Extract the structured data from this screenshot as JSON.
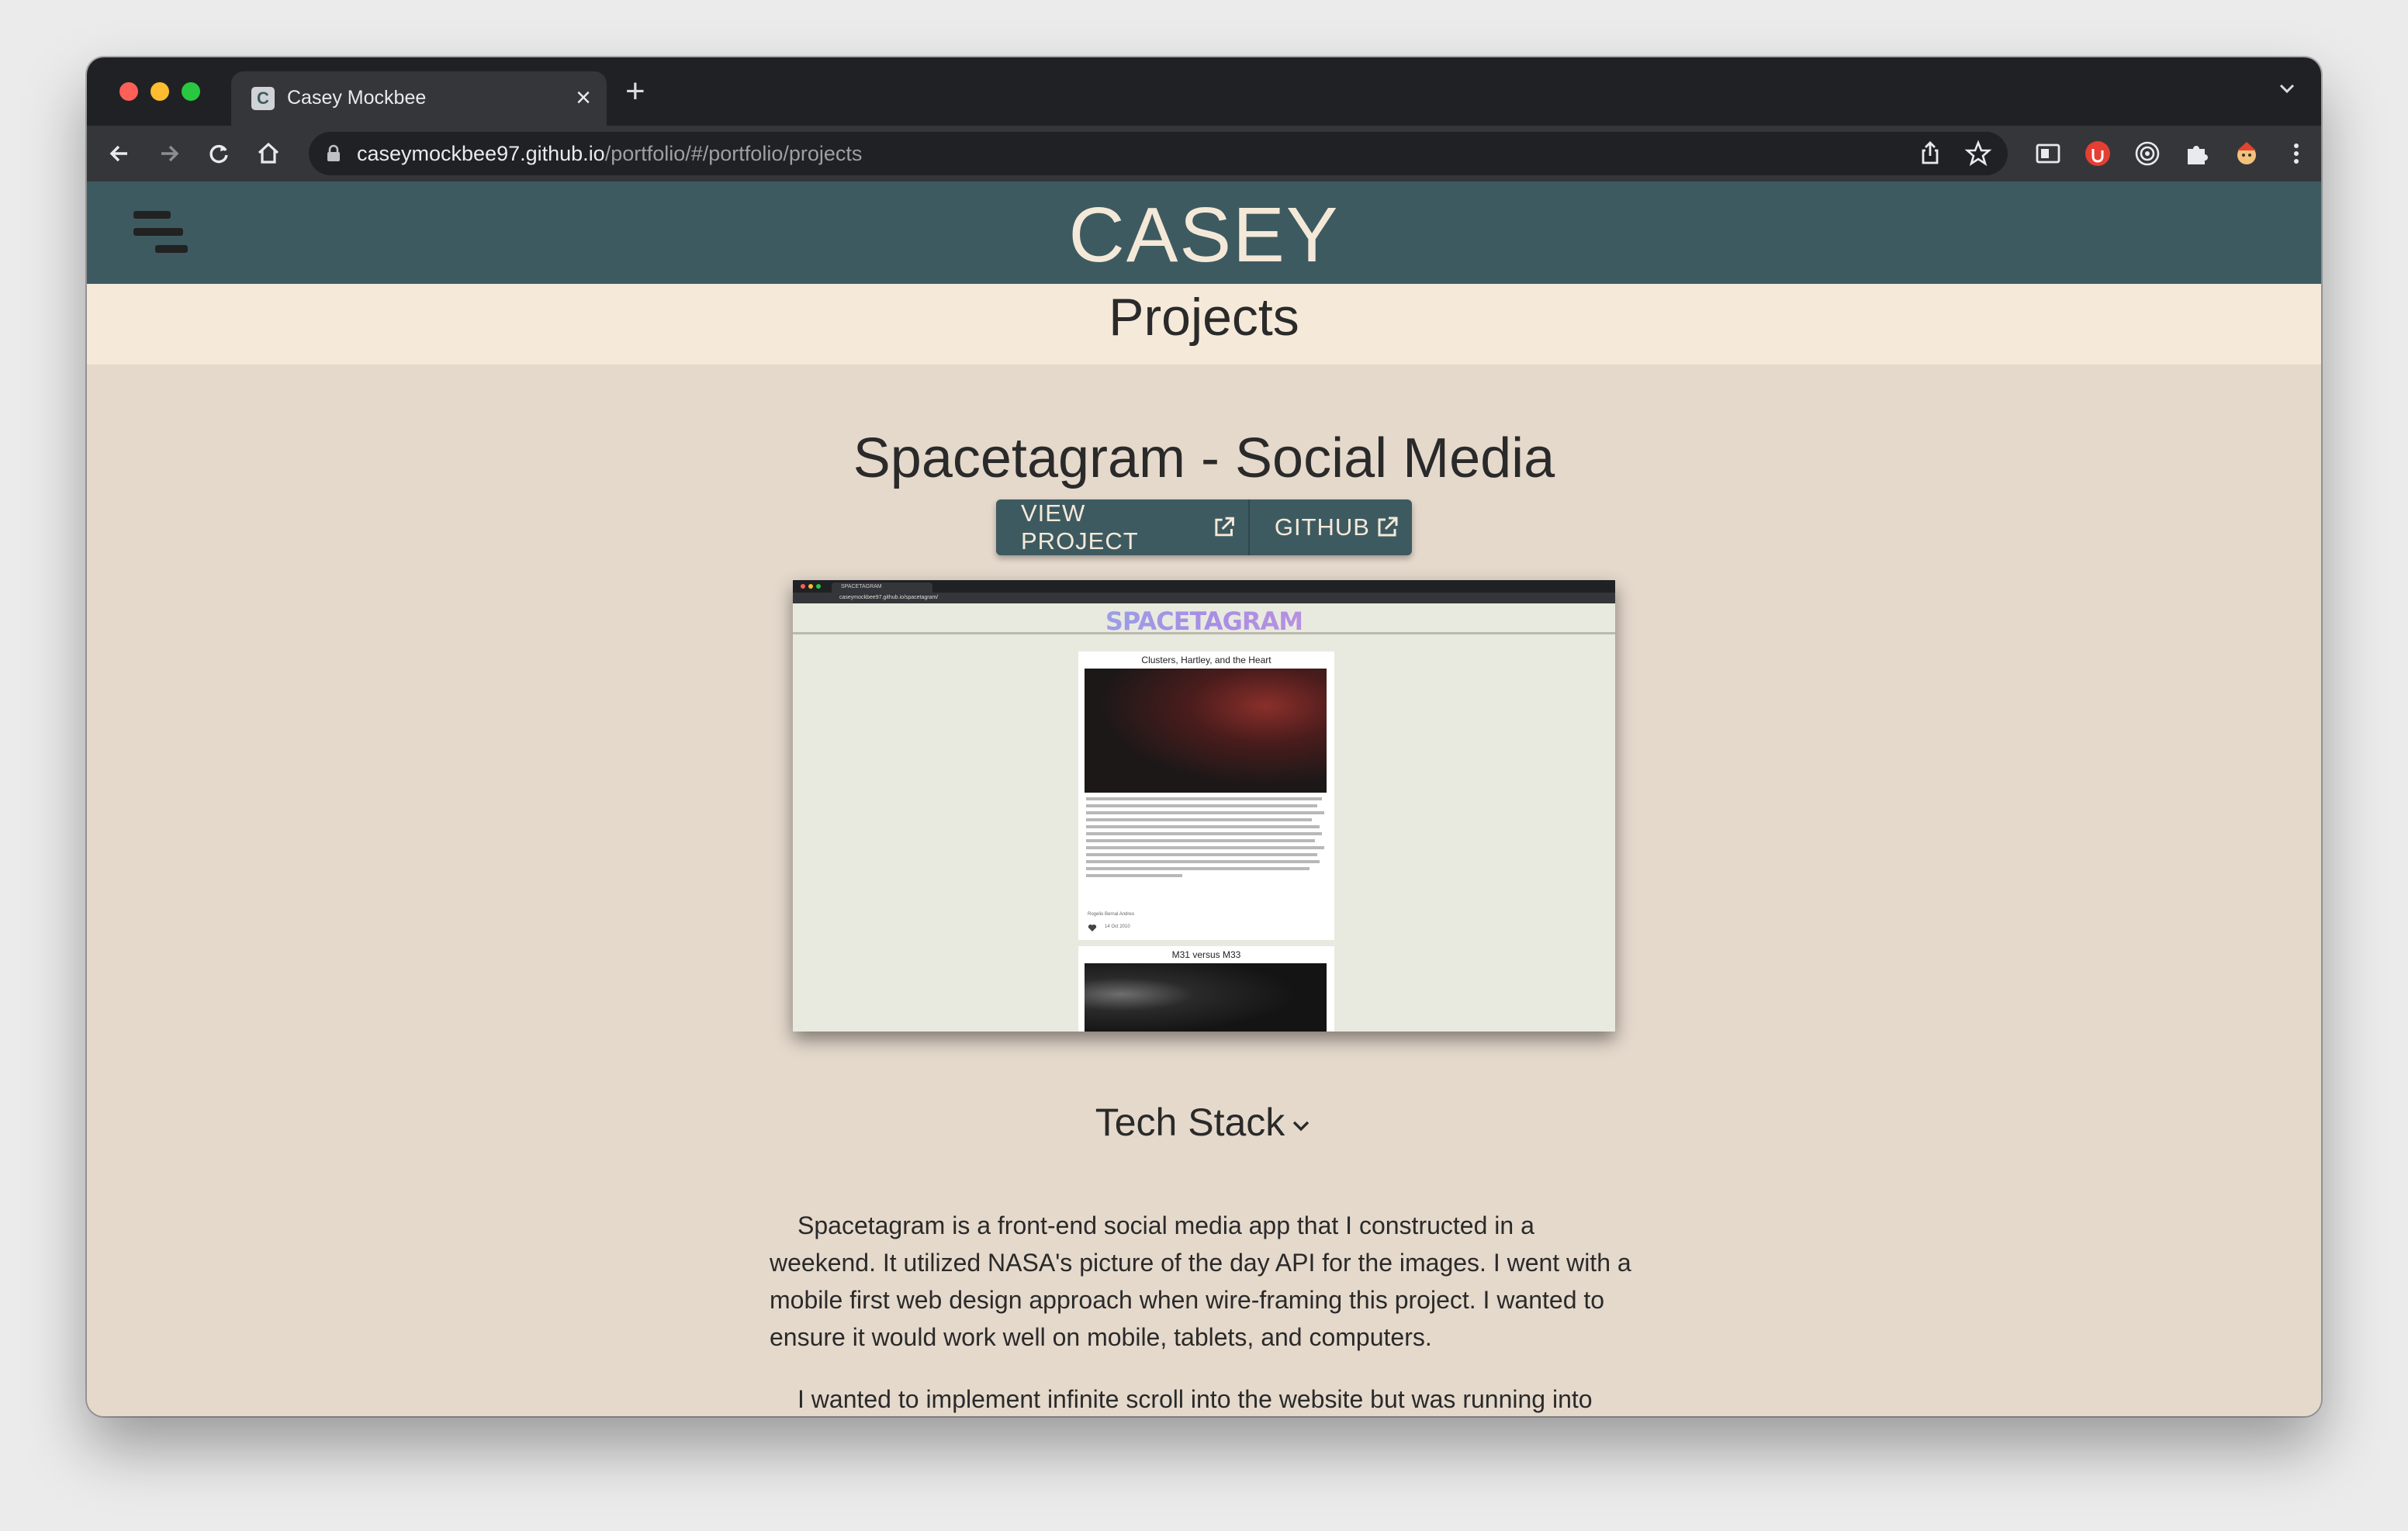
{
  "browser": {
    "tab_title": "Casey Mockbee",
    "favicon_letter": "C",
    "url_host": "caseymockbee97.github.io",
    "url_path": "/portfolio/#/portfolio/projects"
  },
  "site": {
    "title": "CASEY",
    "section_title": "Projects"
  },
  "project": {
    "title": "Spacetagram - Social Media",
    "view_label": "VIEW PROJECT",
    "github_label": "GITHUB",
    "tech_stack_label": "Tech Stack",
    "paragraphs": [
      "Spacetagram is a front-end social media app that I constructed in a weekend. It utilized NASA's picture of the day API for the images. I went with a mobile first web design approach when wire-framing this project. I wanted to ensure it would work well on mobile, tablets, and computers.",
      "I wanted to implement infinite scroll into the website but was running into multiple errors using pre-made react components. So I ended up implementing my own infinite scroll feature by creating a custom hook that"
    ]
  },
  "preview": {
    "tab_label": "SPACETAGRAM",
    "url": "caseymockbee97.github.io/spacetagram/",
    "logo": "SPACETAGRAM",
    "card1_title": "Clusters, Hartley, and the Heart",
    "card1_credit": "Rogelio Bernal Andreo",
    "card1_date": "14 Oct 2010",
    "card2_title": "M31 versus M33"
  },
  "colors": {
    "header_bg": "#3e5a61",
    "page_bg": "#e5d9cc",
    "subbar_bg": "#f5e9d9",
    "title_color": "#f4e9d8"
  }
}
